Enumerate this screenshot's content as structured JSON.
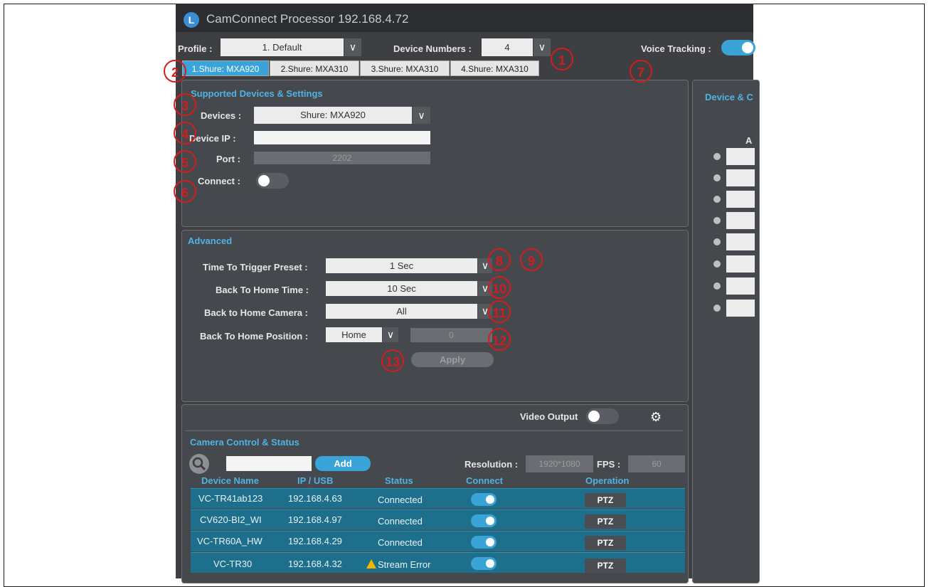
{
  "app": {
    "title": "CamConnect Processor 192.168.4.72",
    "logo_text": "L"
  },
  "header": {
    "profile_label": "Profile :",
    "profile_value": "1. Default",
    "device_numbers_label": "Device Numbers :",
    "device_numbers_value": "4",
    "voice_tracking_label": "Voice Tracking :"
  },
  "tabs": [
    {
      "label": "1.Shure: MXA920"
    },
    {
      "label": "2.Shure: MXA310"
    },
    {
      "label": "3.Shure: MXA310"
    },
    {
      "label": "4.Shure: MXA310"
    }
  ],
  "supported": {
    "title": "Supported Devices & Settings",
    "devices_label": "Devices :",
    "devices_value": "Shure: MXA920",
    "ip_label": "Device IP :",
    "ip_value": "",
    "port_label": "Port :",
    "port_value": "2202",
    "connect_label": "Connect :"
  },
  "right_panel": {
    "title": "Device & C",
    "column_header": "A"
  },
  "advanced": {
    "title": "Advanced",
    "trigger_label": "Time To Trigger Preset :",
    "trigger_value": "1 Sec",
    "home_time_label": "Back To Home Time :",
    "home_time_value": "10 Sec",
    "home_camera_label": "Back to Home Camera :",
    "home_camera_value": "All",
    "home_position_label": "Back To Home Position :",
    "home_position_value": "Home",
    "home_position_number": "0",
    "apply_label": "Apply"
  },
  "camera": {
    "video_output_label": "Video Output",
    "title": "Camera Control & Status",
    "add_label": "Add",
    "resolution_label": "Resolution :",
    "resolution_value": "1920*1080",
    "fps_label": "FPS :",
    "fps_value": "60",
    "columns": [
      "Device Name",
      "IP / USB",
      "Status",
      "Connect",
      "Operation"
    ],
    "rows": [
      {
        "name": "VC-TR41ab123",
        "ip": "192.168.4.63",
        "status": "Connected",
        "op": "PTZ"
      },
      {
        "name": "CV620-BI2_WI",
        "ip": "192.168.4.97",
        "status": "Connected",
        "op": "PTZ"
      },
      {
        "name": "VC-TR60A_HW",
        "ip": "192.168.4.29",
        "status": "Connected",
        "op": "PTZ"
      },
      {
        "name": "VC-TR30",
        "ip": "192.168.4.32",
        "status": "Stream Error",
        "op": "PTZ"
      }
    ]
  },
  "callouts": [
    "1",
    "2",
    "3",
    "4",
    "5",
    "6",
    "7",
    "8",
    "9",
    "10",
    "11",
    "12",
    "13"
  ],
  "colors": {
    "accent": "#3aa4d8",
    "callout": "#d31d1d",
    "row": "#1d6f8c",
    "panel": "#45484c"
  }
}
